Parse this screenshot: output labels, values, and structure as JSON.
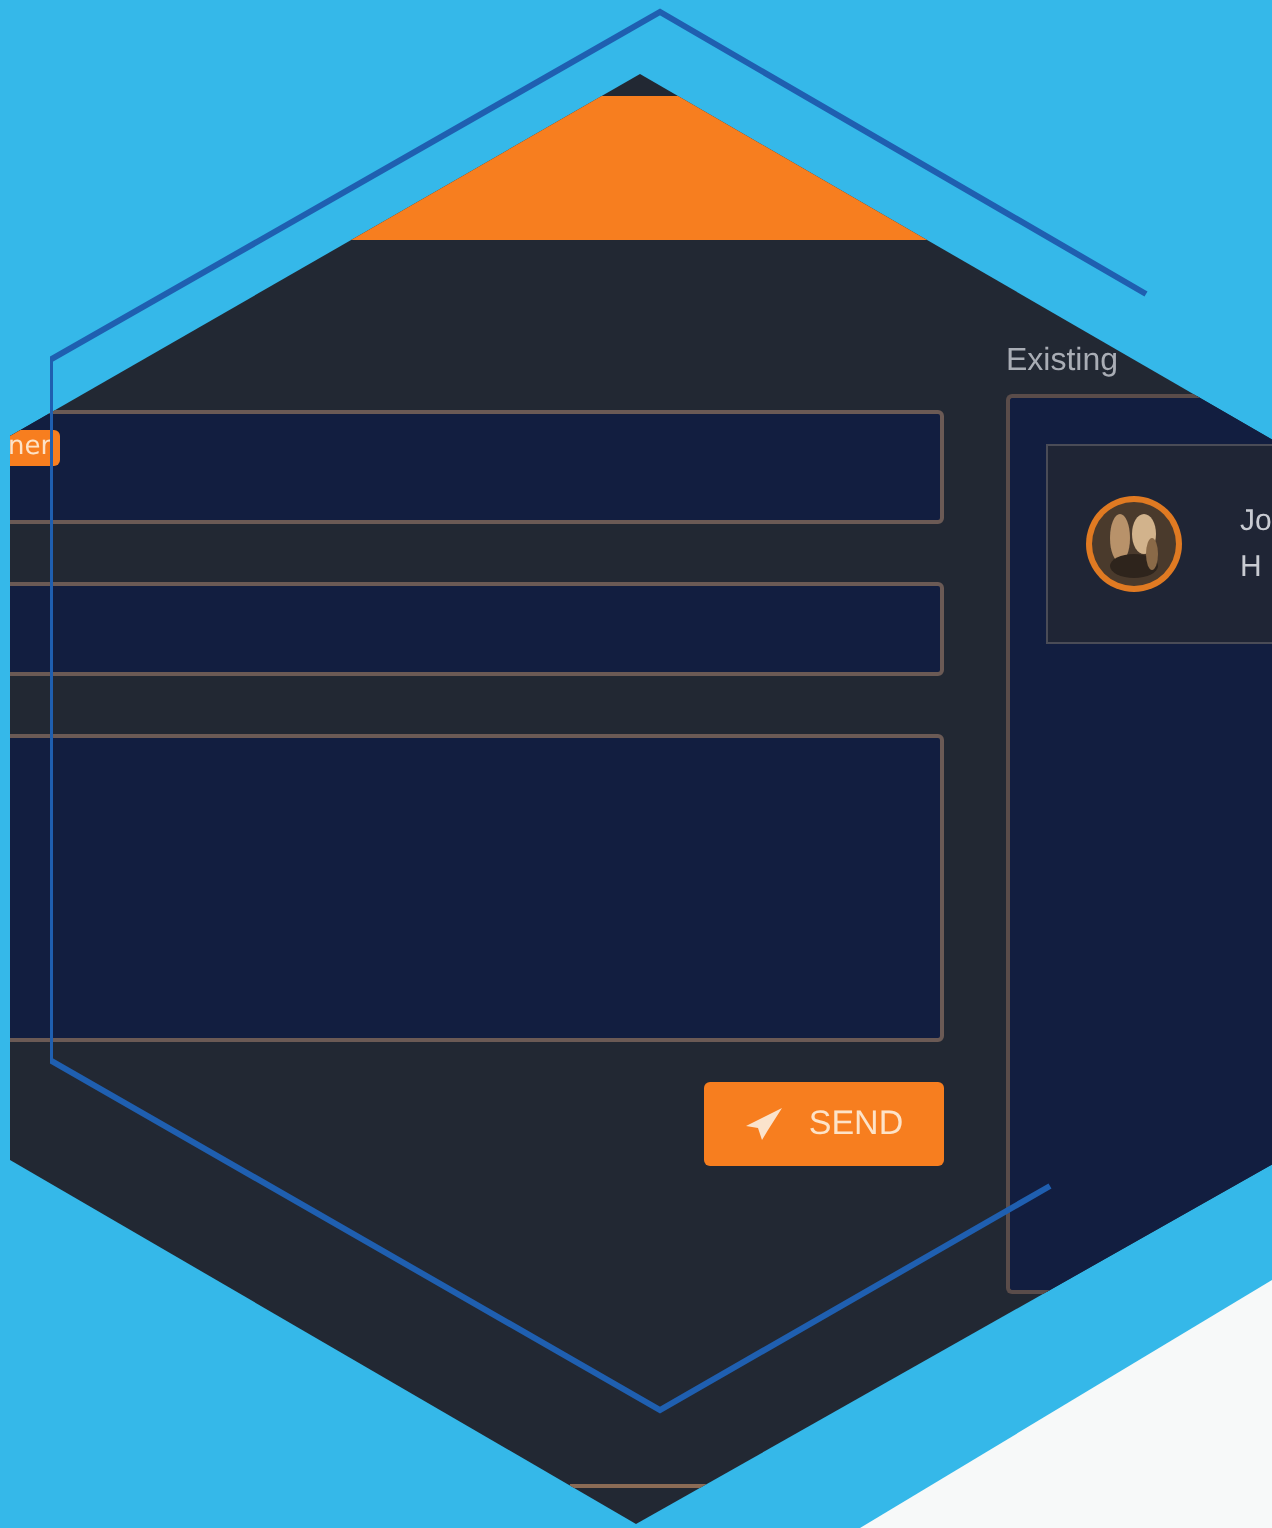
{
  "form": {
    "recipient_tag": "ner"
  },
  "send_button": {
    "label": "SEND"
  },
  "existing": {
    "label": "Existing",
    "contacts": [
      {
        "line_1": "Jo",
        "line_2": "H"
      }
    ]
  }
}
